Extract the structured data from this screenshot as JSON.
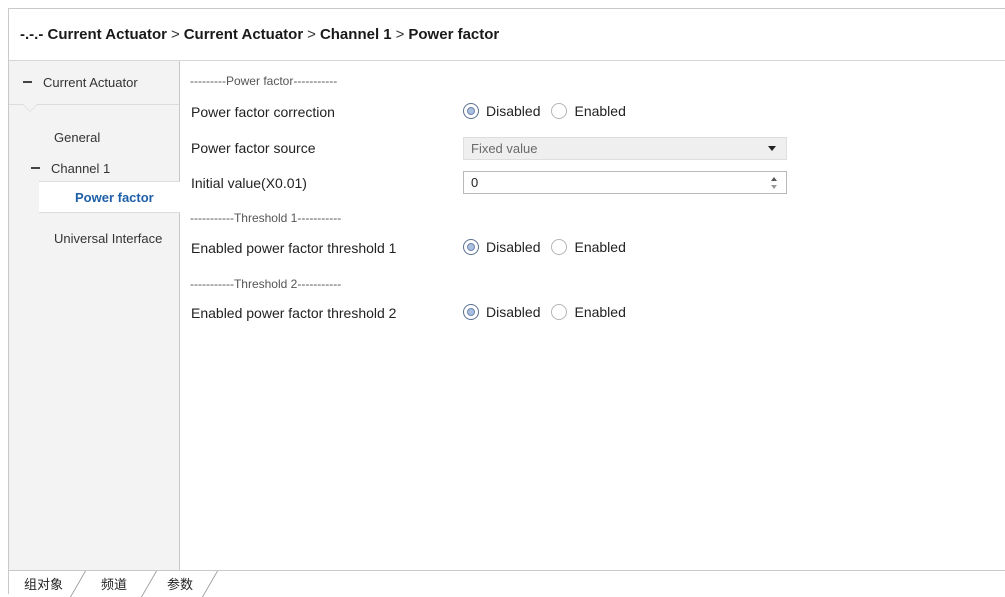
{
  "breadcrumb": {
    "prefix": "-.-.- Current Actuator",
    "sep1": ">",
    "part2": "Current Actuator",
    "sep2": ">",
    "part3": "Channel 1",
    "sep3": ">",
    "part4": "Power factor"
  },
  "sidebar": {
    "root": "Current Actuator",
    "general": "General",
    "channel": "Channel 1",
    "selected": "Power factor",
    "universal": "Universal Interface"
  },
  "content": {
    "header_power": "---------Power factor-----------",
    "pf_correction_label": "Power factor correction",
    "pf_source_label": "Power factor source",
    "pf_source_value": "Fixed value",
    "initial_value_label": "Initial value(X0.01)",
    "initial_value": "0",
    "header_t1": "-----------Threshold 1-----------",
    "t1_label": "Enabled power factor threshold 1",
    "header_t2": "-----------Threshold 2-----------",
    "t2_label": "Enabled power factor threshold 2",
    "disabled": "Disabled",
    "enabled": "Enabled"
  },
  "bottom_tabs": [
    "组对象",
    "频道",
    "参数"
  ],
  "colors": {
    "selected_text": "#1e5fa8",
    "sidebar_bg": "#f3f3f3"
  }
}
